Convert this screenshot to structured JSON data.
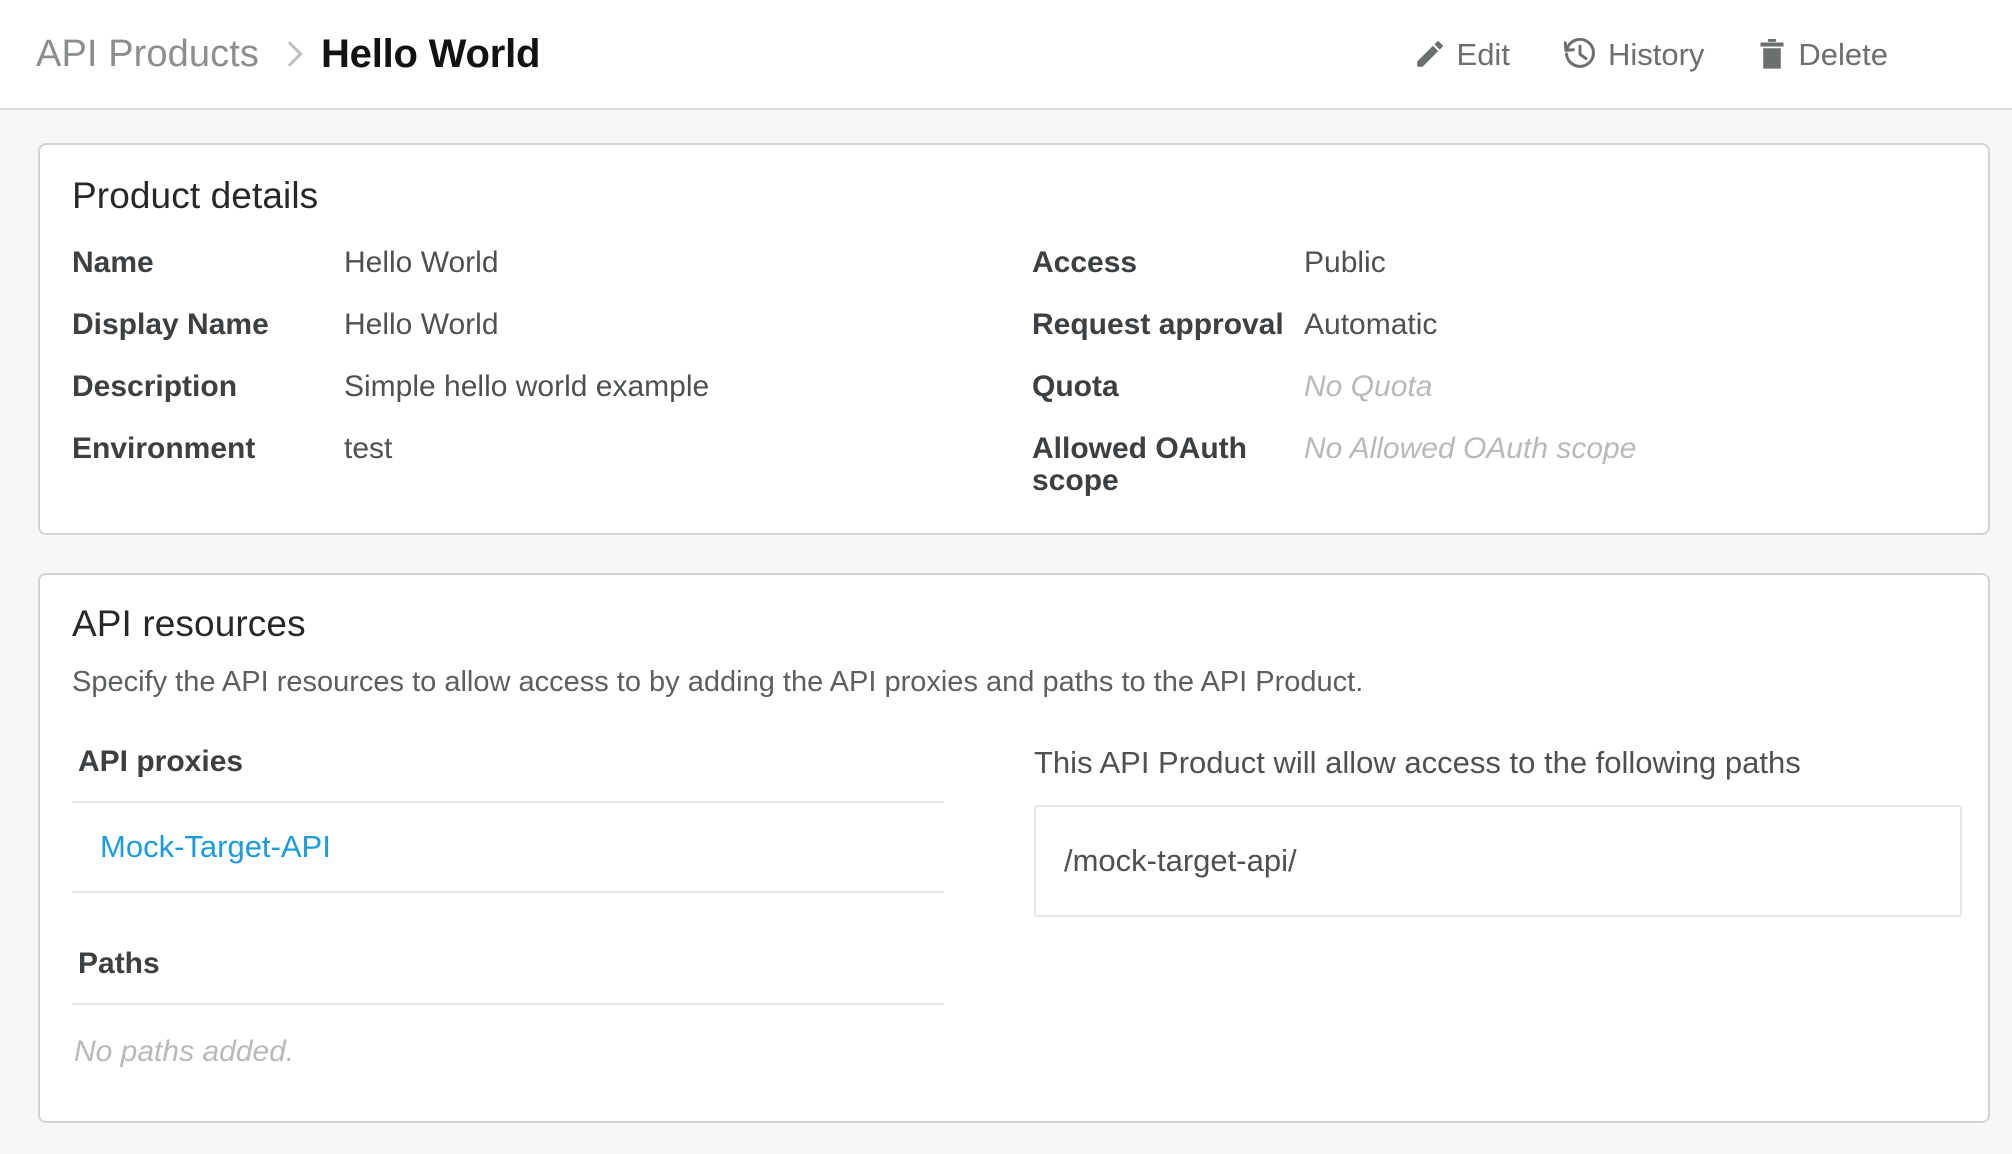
{
  "header": {
    "breadcrumb": {
      "parent": "API Products",
      "separator_icon": "chevron-right-icon",
      "current": "Hello World"
    },
    "actions": [
      {
        "label": "Edit",
        "icon": "pencil-icon"
      },
      {
        "label": "History",
        "icon": "clock-history-icon"
      },
      {
        "label": "Delete",
        "icon": "trash-icon"
      }
    ]
  },
  "product_details": {
    "title": "Product details",
    "left": [
      {
        "label": "Name",
        "value": "Hello World",
        "empty": false
      },
      {
        "label": "Display Name",
        "value": "Hello World",
        "empty": false
      },
      {
        "label": "Description",
        "value": "Simple hello world example",
        "empty": false
      },
      {
        "label": "Environment",
        "value": "test",
        "empty": false
      }
    ],
    "right": [
      {
        "label": "Access",
        "value": "Public",
        "empty": false
      },
      {
        "label": "Request approval",
        "value": "Automatic",
        "empty": false
      },
      {
        "label": "Quota",
        "value": "No Quota",
        "empty": true
      },
      {
        "label": "Allowed OAuth scope",
        "value": "No Allowed OAuth scope",
        "empty": true
      }
    ]
  },
  "api_resources": {
    "title": "API resources",
    "description": "Specify the API resources to allow access to by adding the API proxies and paths to the API Product.",
    "proxies_label": "API proxies",
    "proxies": [
      "Mock-Target-API"
    ],
    "paths_label": "Paths",
    "paths_empty_note": "No paths added.",
    "paths_intro": "This API Product will allow access to the following paths",
    "allowed_paths": [
      "/mock-target-api/"
    ]
  },
  "colors": {
    "link": "#1c9cdc",
    "page_bg": "#f6f8f8",
    "card_border": "#d0d4d4",
    "muted_text": "#b6baba",
    "icon": "#6b6f70"
  }
}
